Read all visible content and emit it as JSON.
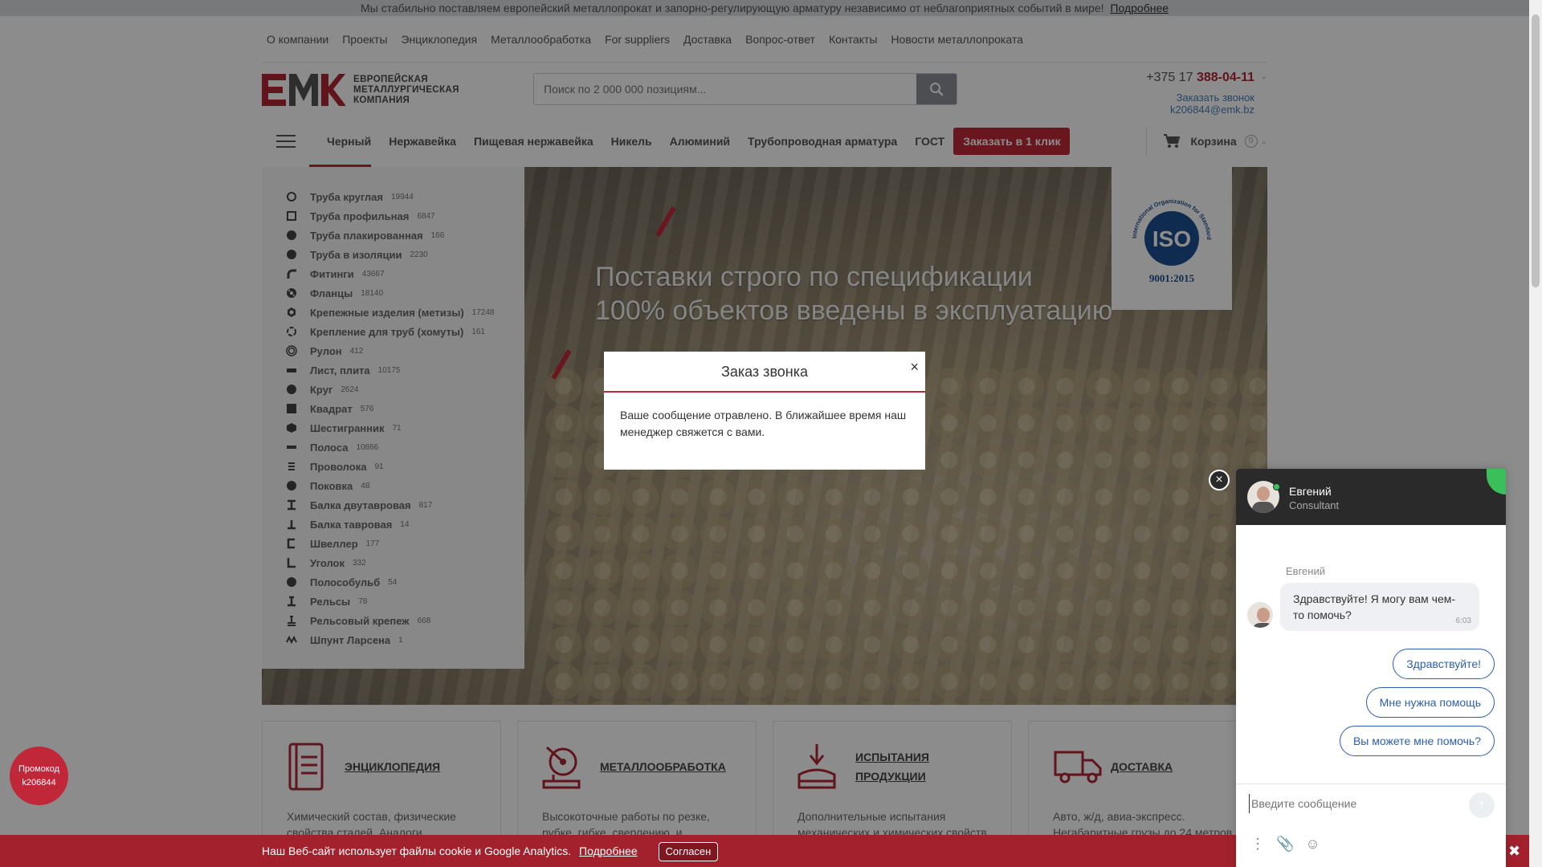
{
  "notice": {
    "text": "Мы стабильно поставляем европейский металлопрокат и запорно-регулирующую арматуру независимо от неблагоприятных событий в мире!",
    "more": "Подробнее"
  },
  "topnav": [
    "О компании",
    "Проекты",
    "Энциклопедия",
    "Металлообработка",
    "For suppliers",
    "Доставка",
    "Вопрос-ответ",
    "Контакты",
    "Новости металлопроката"
  ],
  "logo": {
    "lines": [
      "ЕВРОПЕЙСКАЯ",
      "МЕТАЛЛУРГИЧЕСКАЯ",
      "КОМПАНИЯ"
    ]
  },
  "search": {
    "placeholder": "Поиск по 2 000 000 позициям..."
  },
  "contact": {
    "phone_prefix": "+375 17 ",
    "phone_main": "388-04-11",
    "callback": "Заказать звонок",
    "email": "k206844@emk.bz"
  },
  "catnav": {
    "items": [
      "Черный",
      "Нержавейка",
      "Пищевая нержавейка",
      "Никель",
      "Алюминий",
      "Трубопроводная арматура",
      "ГОСТ"
    ],
    "oneclick": "Заказать в 1 клик",
    "cart": "Корзина",
    "cart_count": "0"
  },
  "menu": [
    {
      "label": "Труба круглая",
      "count": "19944",
      "icon": "circle-outline-icon"
    },
    {
      "label": "Труба профильная",
      "count": "6847",
      "icon": "square-outline-icon"
    },
    {
      "label": "Труба плакированная",
      "count": "166",
      "icon": "circle-icon"
    },
    {
      "label": "Труба в изоляции",
      "count": "2230",
      "icon": "circle-icon"
    },
    {
      "label": "Фитинги",
      "count": "43667",
      "icon": "elbow-icon"
    },
    {
      "label": "Фланцы",
      "count": "18140",
      "icon": "flange-icon"
    },
    {
      "label": "Крепежные изделия (метизы)",
      "count": "17248",
      "icon": "nut-icon"
    },
    {
      "label": "Крепление для труб (хомуты)",
      "count": "161",
      "icon": "clamp-icon"
    },
    {
      "label": "Рулон",
      "count": "412",
      "icon": "coil-icon"
    },
    {
      "label": "Лист, плита",
      "count": "10175",
      "icon": "sheet-icon"
    },
    {
      "label": "Круг",
      "count": "2624",
      "icon": "circle-icon"
    },
    {
      "label": "Квадрат",
      "count": "576",
      "icon": "square-icon"
    },
    {
      "label": "Шестигранник",
      "count": "71",
      "icon": "hexagon-icon"
    },
    {
      "label": "Полоса",
      "count": "10866",
      "icon": "strip-icon"
    },
    {
      "label": "Проволока",
      "count": "91",
      "icon": "wire-icon"
    },
    {
      "label": "Поковка",
      "count": "48",
      "icon": "circle-icon"
    },
    {
      "label": "Балка двутавровая",
      "count": "817",
      "icon": "i-beam-icon"
    },
    {
      "label": "Балка тавровая",
      "count": "14",
      "icon": "t-beam-icon"
    },
    {
      "label": "Швеллер",
      "count": "177",
      "icon": "channel-icon"
    },
    {
      "label": "Уголок",
      "count": "332",
      "icon": "angle-icon"
    },
    {
      "label": "Полособульб",
      "count": "54",
      "icon": "bulb-bar-icon"
    },
    {
      "label": "Рельсы",
      "count": "78",
      "icon": "rail-icon"
    },
    {
      "label": "Рельсовый крепеж",
      "count": "668",
      "icon": "rail-fastener-icon"
    },
    {
      "label": "Шпунт Ларсена",
      "count": "1",
      "icon": "sheet-pile-icon"
    }
  ],
  "hero": {
    "line1": "Поставки строго по спецификации",
    "line2": "100% объектов введены в эксплуатацию*",
    "iso_label": "ISO",
    "iso_sub": "9001:2015",
    "iso_ring": "International Organization for Standardization"
  },
  "cards": [
    {
      "title": "ЭНЦИКЛОПЕДИЯ",
      "text": "Химический состав, физические свойства сталей. Аналоги,",
      "icon": "book-icon"
    },
    {
      "title": "МЕТАЛЛООБРАБОТКА",
      "text": "Высокоточные работы по резке, рубке, гибке, сверлению, и",
      "icon": "saw-icon"
    },
    {
      "title": "ИСПЫТАНИЯ ПРОДУКЦИИ",
      "title2": "ПРОДУКЦИИ",
      "title1": "ИСПЫТАНИЯ",
      "text": "Дополнительные испытания механических и химических свойств",
      "icon": "press-icon"
    },
    {
      "title": "ДОСТАВКА",
      "text": "Авто, ж/д, авиа-экспресс. Негабаритные грузы до 24 метров.",
      "icon": "truck-icon"
    }
  ],
  "modal": {
    "title": "Заказ звонка",
    "close": "×",
    "body": "Ваше сообщение отравлено. В ближайшее время наш менеджер свяжется с вами."
  },
  "cookie": {
    "text": "Наш Веб-сайт использует файлы cookie и Google Analytics.",
    "more": "Подробнее",
    "accept": "Согласен",
    "close": "✖"
  },
  "promo": {
    "line1": "Промокод",
    "line2": "k206844"
  },
  "chat": {
    "agent_name": "Евгений",
    "agent_role": "Consultant",
    "message_sender": "Евгений",
    "message": "Здравствуйте! Я могу вам чем-то помочь?",
    "time": "6:03",
    "quick_replies": [
      "Здравствуйте!",
      "Мне нужна помощь",
      "Вы можете мне помочь?"
    ],
    "input_placeholder": "Введите сообщение",
    "close": "×"
  }
}
